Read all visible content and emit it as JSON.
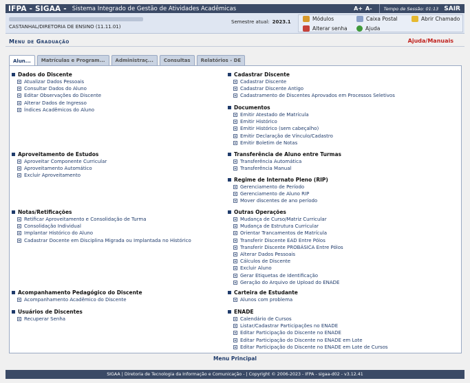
{
  "topbar": {
    "brand": "IFPA - SIGAA -",
    "system_name": "Sistema Integrado de Gestão de Atividades Acadêmicas",
    "font_larger": "A+",
    "font_smaller": "A-",
    "session_label": "Tempo de Sessão: 01:13",
    "logout": "SAIR"
  },
  "userbar": {
    "unit": "CASTANHAL/DIRETORIA DE ENSINO (11.11.01)",
    "semester_label": "Semestre atual:",
    "semester_value": "2023.1",
    "links": {
      "modulos": "Módulos",
      "caixa_postal": "Caixa Postal",
      "abrir_chamado": "Abrir Chamado",
      "alterar_senha": "Alterar senha",
      "ajuda": "Ajuda"
    }
  },
  "menu": {
    "title": "Menu de Graduação",
    "help": "Ajuda/Manuais"
  },
  "tabs": [
    "Alun...",
    "Matrículas e Program...",
    "Administraç...",
    "Consultas",
    "Relatórios - DE"
  ],
  "left_sections": [
    {
      "title": "Dados do Discente",
      "items": [
        "Atualizar Dados Pessoais",
        "Consultar Dados do Aluno",
        "Editar Observações do Discente",
        "Alterar Dados de Ingresso",
        "Índices Acadêmicos do Aluno"
      ]
    },
    {
      "title": "Aproveitamento de Estudos",
      "items": [
        "Aproveitar Componente Curricular",
        "Aproveitamento Automático",
        "Excluir Aproveitamento"
      ]
    },
    {
      "title": "Notas/Retificações",
      "items": [
        "Retificar Aproveitamento e Consolidação de Turma",
        "Consolidação Individual",
        "Implantar Histórico do Aluno",
        "Cadastrar Docente em Disciplina Migrada ou Implantada no Histórico"
      ]
    },
    {
      "title": "Acompanhamento Pedagógico do Discente",
      "items": [
        "Acompanhamento Acadêmico do Discente"
      ]
    },
    {
      "title": "Usuários de Discentes",
      "items": [
        "Recuperar Senha"
      ]
    }
  ],
  "right_sections": [
    {
      "title": "Cadastrar Discente",
      "items": [
        "Cadastrar Discente",
        "Cadastrar Discente Antigo",
        "Cadastramento de Discentes Aprovados em Processos Seletivos"
      ]
    },
    {
      "title": "Documentos",
      "items": [
        "Emitir Atestado de Matrícula",
        "Emitir Histórico",
        "Emitir Histórico (sem cabeçalho)",
        "Emitir Declaração de Vínculo/Cadastro",
        "Emitir Boletim de Notas"
      ]
    },
    {
      "title": "Transferência de Aluno entre Turmas",
      "items": [
        "Transferência Automática",
        "Transferência Manual"
      ]
    },
    {
      "title": "Regime de Internato Pleno (RIP)",
      "items": [
        "Gerenciamento de Período",
        "Gerenciamento de Aluno RIP",
        "Mover discentes de ano período"
      ]
    },
    {
      "title": "Outras Operações",
      "items": [
        "Mudança de Curso/Matriz Curricular",
        "Mudança de Estrutura Curricular",
        "Orientar Trancamentos de Matrícula",
        "Transferir Discente EAD Entre Pólos",
        "Transferir Discente PROBÁSICA Entre Pólos",
        "Alterar Dados Pessoais",
        "Cálculos de Discente",
        "Excluir Aluno",
        "Gerar Etiquetas de Identificação",
        "Geração do Arquivo de Upload do ENADE"
      ]
    },
    {
      "title": "Carteira de Estudante",
      "items": [
        "Alunos com problema"
      ]
    },
    {
      "title": "ENADE",
      "items": [
        "Calendário de Cursos",
        "Listar/Cadastrar Participações no ENADE",
        "Editar Participação do Discente no ENADE",
        "Editar Participação do Discente no ENADE em Lote",
        "Editar Participação do Discente no ENADE em Lote de Cursos"
      ]
    }
  ],
  "footer": {
    "main_menu": "Menu Principal",
    "text": "SIGAA | Diretoria de Tecnologia da Informação e Comunicação - | Copyright © 2006-2023 - IFPA - sigaa-d02 - v3.12.41"
  },
  "colors": {
    "header_bg": "#3b4a66",
    "link": "#1f3b6b",
    "help_red": "#c0211d"
  }
}
